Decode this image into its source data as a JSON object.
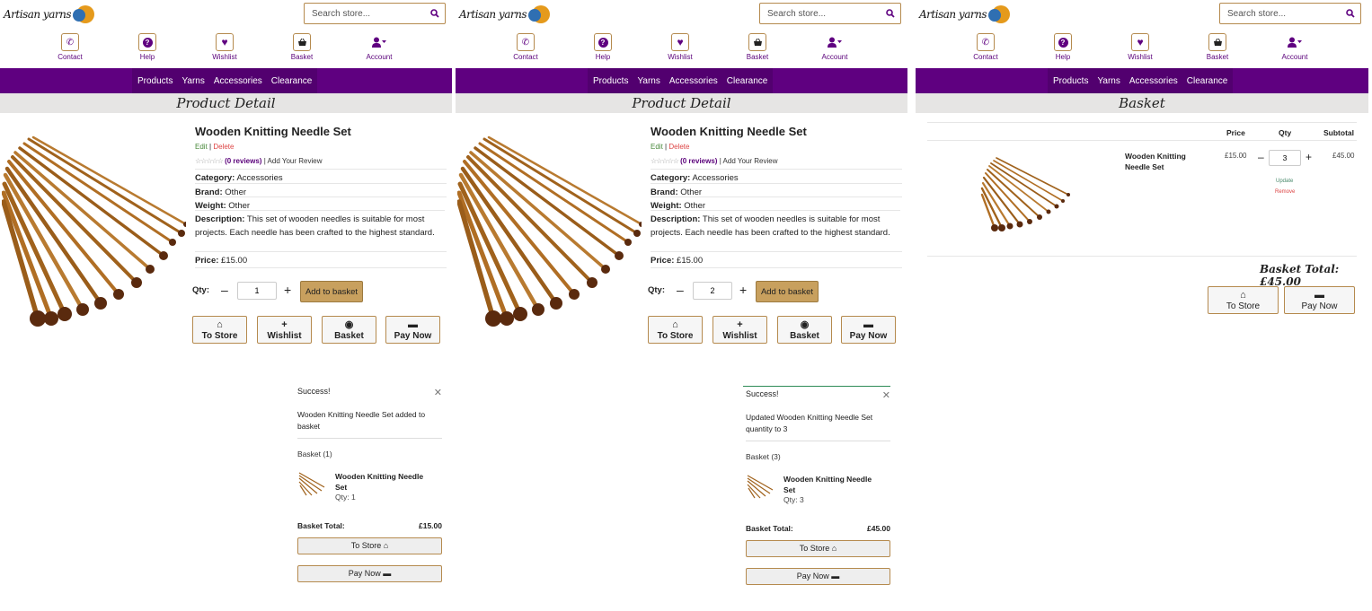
{
  "header": {
    "logo_text": "Artisan yarns",
    "search_placeholder": "Search store...",
    "nav_icons": [
      {
        "label": "Contact",
        "icon": "phone-icon"
      },
      {
        "label": "Help",
        "icon": "question-icon"
      },
      {
        "label": "Wishlist",
        "icon": "heart-icon"
      },
      {
        "label": "Basket",
        "icon": "basket-icon"
      },
      {
        "label": "Account",
        "icon": "user-icon"
      }
    ],
    "menu": [
      "Products",
      "Yarns",
      "Accessories",
      "Clearance"
    ]
  },
  "colors": {
    "brand_purple": "#5f0080",
    "accent_gold": "#c8a05e",
    "border_gold": "#b58a4e"
  },
  "product_panels": [
    {
      "page_title": "Product Detail",
      "product": {
        "name": "Wooden Knitting Needle Set",
        "edit": "Edit",
        "sep": "|",
        "delete": "Delete",
        "stars": "☆☆☆☆☆",
        "reviews": "(0 reviews)",
        "add_review": "| Add Your Review",
        "category_label": "Category:",
        "category": "Accessories",
        "brand_label": "Brand:",
        "brand": "Other",
        "weight_label": "Weight:",
        "weight": "Other",
        "description_label": "Description:",
        "description": "This set of wooden needles is suitable for most projects. Each needle has been crafted to the highest standard.",
        "price_label": "Price:",
        "price": "£15.00"
      },
      "qty_label": "Qty:",
      "qty_value": "1",
      "add_to_basket": "Add to basket",
      "actions": [
        "To Store",
        "Wishlist",
        "Basket",
        "Pay Now"
      ],
      "toast": {
        "title": "Success!",
        "message": "Wooden Knitting Needle Set added to basket",
        "basket_label": "Basket (1)",
        "item_name": "Wooden Knitting Needle Set",
        "item_qty": "Qty: 1",
        "total_label": "Basket Total:",
        "total": "£15.00",
        "to_store": "To Store",
        "pay_now": "Pay Now"
      }
    },
    {
      "page_title": "Product Detail",
      "product": {
        "name": "Wooden Knitting Needle Set",
        "edit": "Edit",
        "sep": "|",
        "delete": "Delete",
        "stars": "☆☆☆☆☆",
        "reviews": "(0 reviews)",
        "add_review": "| Add Your Review",
        "category_label": "Category:",
        "category": "Accessories",
        "brand_label": "Brand:",
        "brand": "Other",
        "weight_label": "Weight:",
        "weight": "Other",
        "description_label": "Description:",
        "description": "This set of wooden needles is suitable for most projects. Each needle has been crafted to the highest standard.",
        "price_label": "Price:",
        "price": "£15.00"
      },
      "qty_label": "Qty:",
      "qty_value": "2",
      "add_to_basket": "Add to basket",
      "actions": [
        "To Store",
        "Wishlist",
        "Basket",
        "Pay Now"
      ],
      "toast": {
        "title": "Success!",
        "message": "Updated Wooden Knitting Needle Set quantity to 3",
        "basket_label": "Basket (3)",
        "item_name": "Wooden Knitting Needle Set",
        "item_qty": "Qty: 3",
        "total_label": "Basket Total:",
        "total": "£45.00",
        "to_store": "To Store",
        "pay_now": "Pay Now"
      }
    }
  ],
  "basket_panel": {
    "page_title": "Basket",
    "columns": [
      "Price",
      "Qty",
      "Subtotal"
    ],
    "item": {
      "name": "Wooden Knitting Needle Set",
      "price": "£15.00",
      "qty": "3",
      "subtotal": "£45.00",
      "update": "Update",
      "remove": "Remove"
    },
    "total": "Basket Total: £45.00",
    "to_store": "To Store",
    "pay_now": "Pay Now"
  }
}
